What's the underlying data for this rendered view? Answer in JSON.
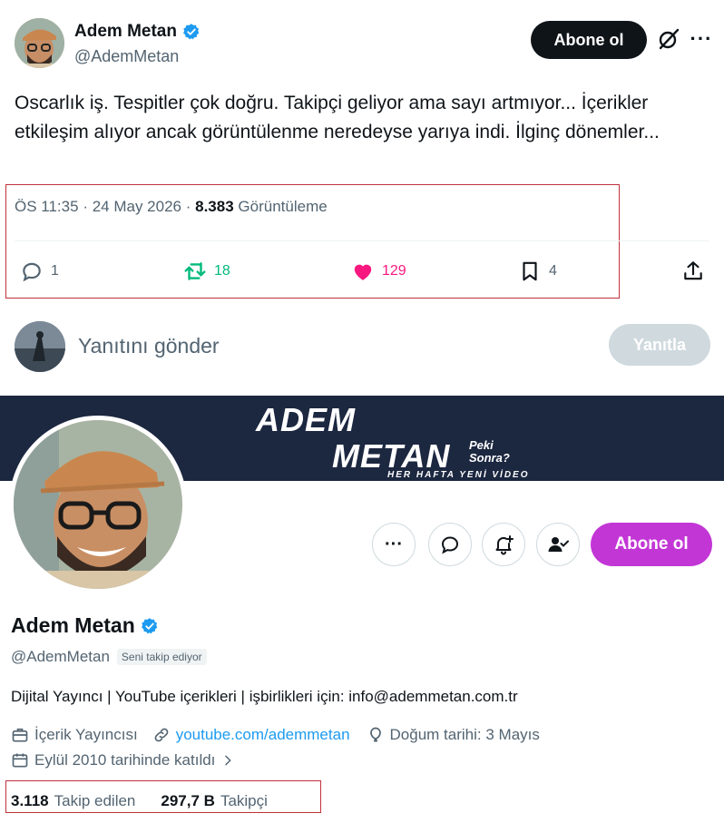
{
  "tweet": {
    "author_name": "Adem Metan",
    "author_handle": "@AdemMetan",
    "subscribe_label": "Abone ol",
    "text": "Oscarlık iş. Tespitler çok doğru. Takipçi geliyor ama sayı artmıyor... İçerikler etkileşim alıyor ancak görüntülenme neredeyse yarıya indi. İlginç dönemler...",
    "time": "ÖS 11:35",
    "date": "24 May 2026",
    "views_count": "8.383",
    "views_label": "Görüntüleme",
    "replies": "1",
    "retweets": "18",
    "likes": "129",
    "bookmarks": "4",
    "colors": {
      "retweet": "#00ba7c",
      "like": "#f91880"
    }
  },
  "reply_box": {
    "placeholder": "Yanıtını gönder",
    "button_label": "Yanıtla"
  },
  "profile": {
    "banner_line1": "ADEM",
    "banner_line2": "METAN",
    "banner_sub": "Peki Sonra?",
    "banner_tag": "HER HAFTA YENİ VİDEO",
    "subscribe_label": "Abone ol",
    "subscribe_color": "#c336d6",
    "name": "Adem Metan",
    "handle": "@AdemMetan",
    "follows_you": "Seni takip ediyor",
    "bio": "Dijital Yayıncı | YouTube içerikleri | işbirlikleri için: info@ademmetan.com.tr",
    "category": "İçerik Yayıncısı",
    "website": "youtube.com/ademmetan",
    "birthday": "Doğum tarihi: 3 Mayıs",
    "joined": "Eylül 2010 tarihinde katıldı",
    "following_count": "3.118",
    "following_label": "Takip edilen",
    "followers_count": "297,7 B",
    "followers_label": "Takipçi"
  },
  "icons": [
    "verified-icon",
    "grok-icon",
    "more-icon",
    "reply-icon",
    "retweet-icon",
    "heart-icon",
    "bookmark-icon",
    "share-icon",
    "message-icon",
    "notify-icon",
    "follow-icon",
    "briefcase-icon",
    "link-icon",
    "balloon-icon",
    "calendar-icon",
    "chevron-right-icon"
  ]
}
